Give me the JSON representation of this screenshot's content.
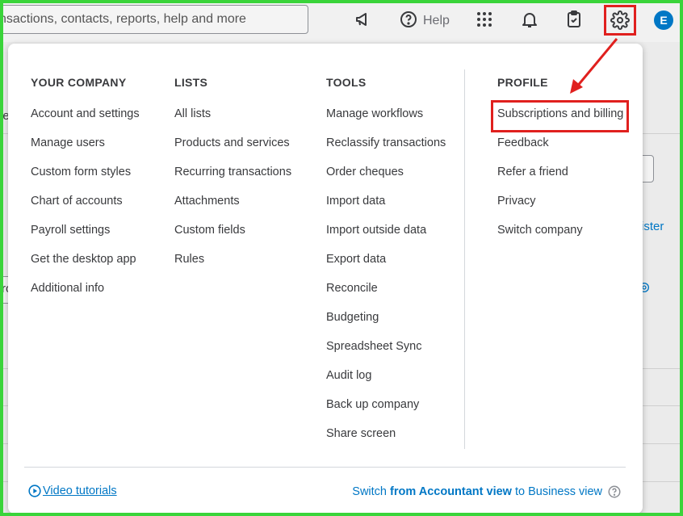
{
  "topbar": {
    "search_text": "nsactions, contacts, reports, help and more",
    "help_label": "Help",
    "avatar_initial": "E"
  },
  "background": {
    "left_fragment_1": "le",
    "left_fragment_2": "ro",
    "right_fragment": "ister"
  },
  "menu": {
    "your_company": {
      "heading": "YOUR COMPANY",
      "items": [
        "Account and settings",
        "Manage users",
        "Custom form styles",
        "Chart of accounts",
        "Payroll settings",
        "Get the desktop app",
        "Additional info"
      ]
    },
    "lists": {
      "heading": "LISTS",
      "items": [
        "All lists",
        "Products and services",
        "Recurring transactions",
        "Attachments",
        "Custom fields",
        "Rules"
      ]
    },
    "tools": {
      "heading": "TOOLS",
      "items": [
        "Manage workflows",
        "Reclassify transactions",
        "Order cheques",
        "Import data",
        "Import outside data",
        "Export data",
        "Reconcile",
        "Budgeting",
        "Spreadsheet Sync",
        "Audit log",
        "Back up company",
        "Share screen"
      ]
    },
    "profile": {
      "heading": "PROFILE",
      "items": [
        "Subscriptions and billing",
        "Feedback",
        "Refer a friend",
        "Privacy",
        "Switch company"
      ]
    },
    "footer": {
      "video_tutorials": "Video tutorials",
      "switch_prefix": "Switch ",
      "switch_bold": "from Accountant view",
      "switch_suffix": " to Business view"
    }
  },
  "colors": {
    "accent": "#0077c5",
    "highlight": "#e0201e",
    "frame": "#3ad43a"
  }
}
